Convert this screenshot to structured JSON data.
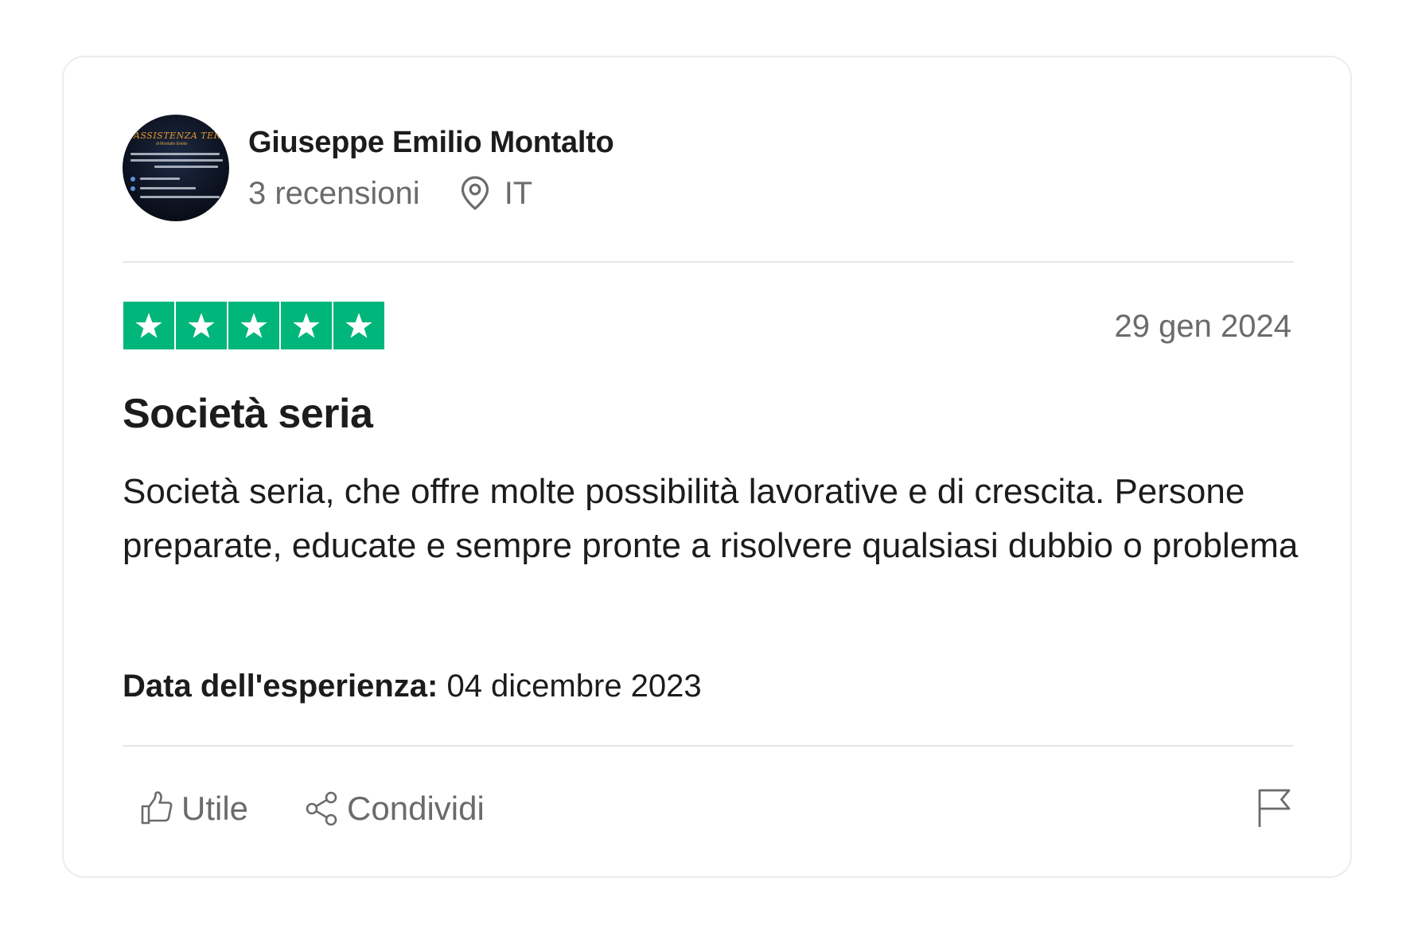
{
  "consumer": {
    "name": "Giuseppe Emilio Montalto",
    "reviews_count": "3 recensioni",
    "country": "IT",
    "avatar_text": {
      "title": "ASSISTENZA TERMO",
      "subtitle": "di Montalto Emilio"
    }
  },
  "review": {
    "rating": 5,
    "date": "29 gen 2024",
    "title": "Società seria",
    "body": "Società seria, che offre molte possibilità lavorative e di crescita. Persone preparate, educate e sempre pronte a risolvere qualsiasi dubbio o problema",
    "experience_label": "Data dell'esperienza:",
    "experience_date": " 04 dicembre 2023"
  },
  "actions": {
    "useful_label": "Utile",
    "share_label": "Condividi"
  },
  "icons": {
    "location": "map-pin-icon",
    "useful": "thumbs-up-icon",
    "share": "share-icon",
    "report": "flag-icon",
    "star": "star-icon"
  },
  "colors": {
    "star_green": "#00b67a",
    "text_primary": "#1c1c1c",
    "text_secondary": "#6b6b6b",
    "border": "#ececec"
  }
}
